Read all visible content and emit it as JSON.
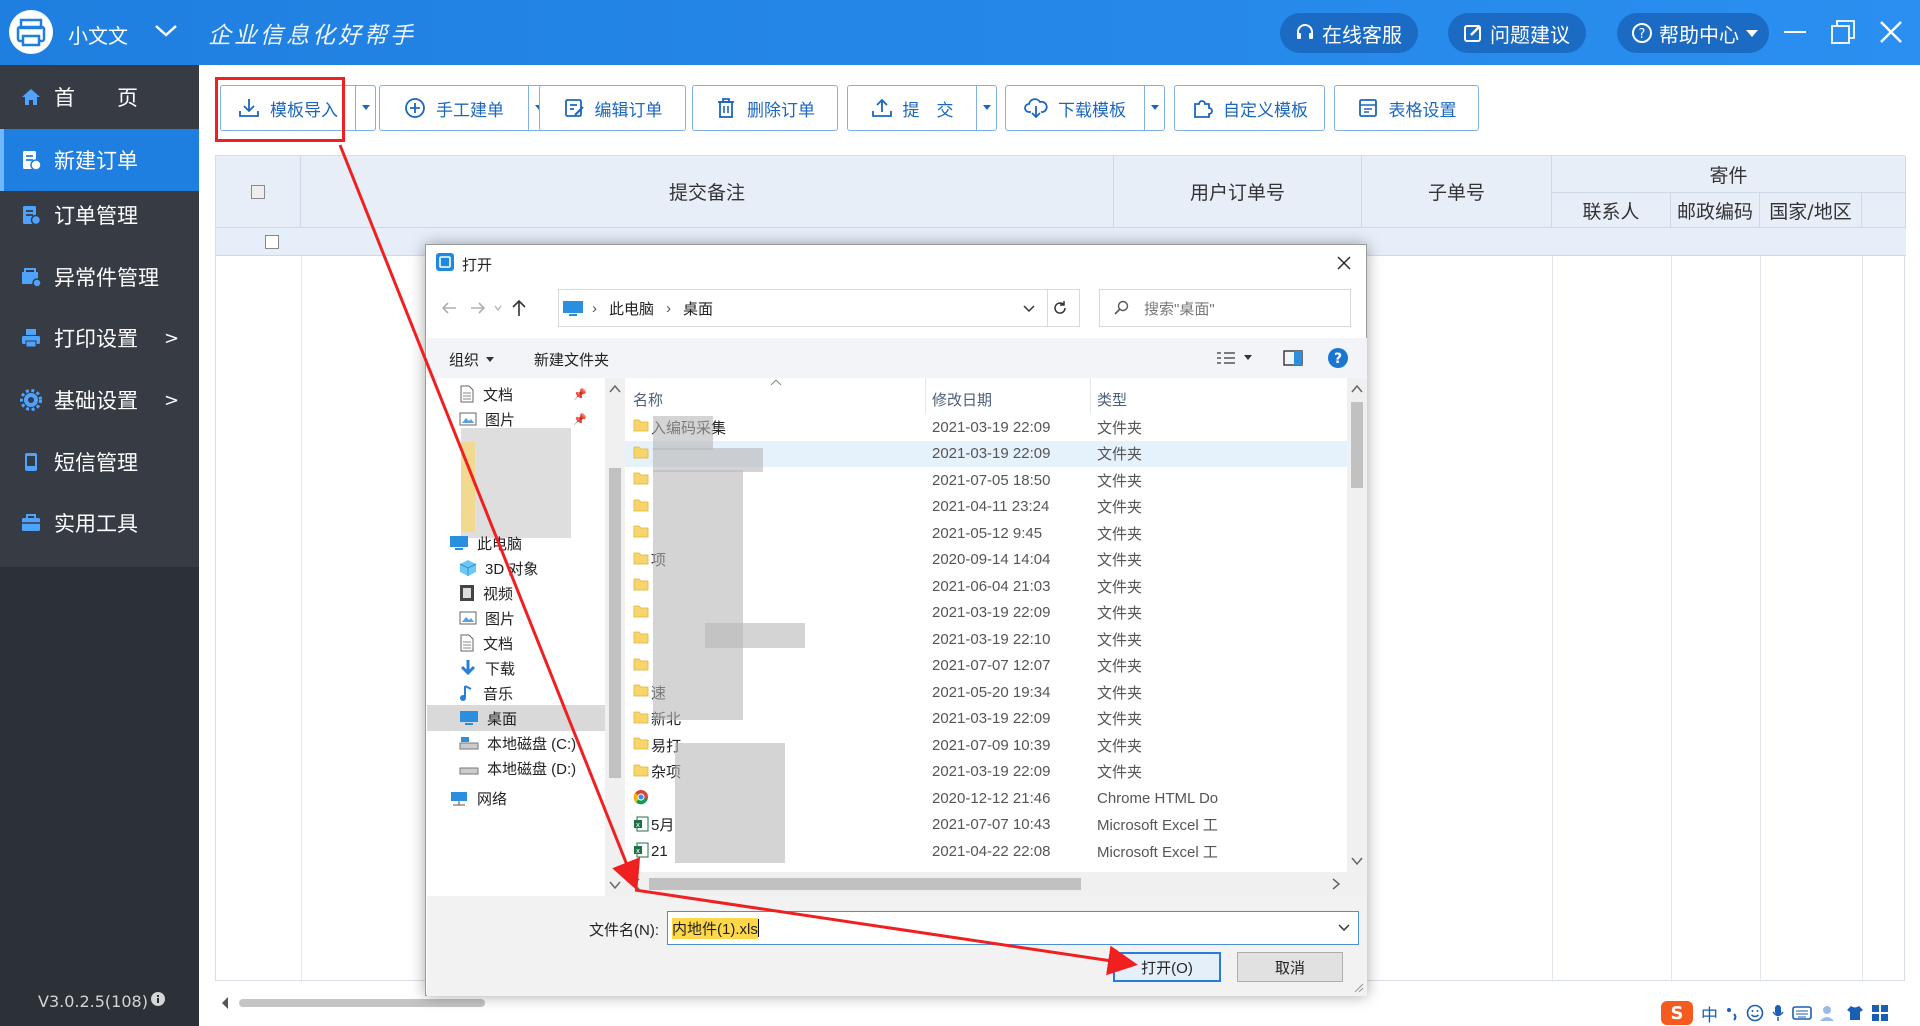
{
  "titlebar": {
    "app_name": "小文文",
    "slogan": "企业信息化好帮手",
    "online_service": "在线客服",
    "feedback": "问题建议",
    "help_center": "帮助中心"
  },
  "sidebar": {
    "items": [
      {
        "label": "首　　页",
        "icon": "home-icon"
      },
      {
        "label": "新建订单",
        "icon": "new-order-icon",
        "active": true
      },
      {
        "label": "订单管理",
        "icon": "order-manage-icon"
      },
      {
        "label": "异常件管理",
        "icon": "exception-icon"
      },
      {
        "label": "打印设置",
        "icon": "printer-icon",
        "arrow": ">"
      },
      {
        "label": "基础设置",
        "icon": "gear-icon",
        "arrow": ">"
      },
      {
        "label": "短信管理",
        "icon": "sms-icon"
      },
      {
        "label": "实用工具",
        "icon": "toolbox-icon"
      }
    ],
    "version": "V3.0.2.5(108)"
  },
  "toolbar": {
    "import_template": "模板导入",
    "manual_order": "手工建单",
    "edit_order": "编辑订单",
    "delete_order": "删除订单",
    "submit": "提　交",
    "download_template": "下载模板",
    "custom_template": "自定义模板",
    "table_settings": "表格设置"
  },
  "table": {
    "headers": {
      "remark": "提交备注",
      "user_order_no": "用户订单号",
      "sub_order_no": "子单号",
      "sender_group": "寄件",
      "contact": "联系人",
      "postcode": "邮政编码",
      "country": "国家/地区"
    }
  },
  "dialog": {
    "title": "打开",
    "breadcrumb": [
      "此电脑",
      "桌面"
    ],
    "search_placeholder": "搜索\"桌面\"",
    "organize": "组织",
    "new_folder": "新建文件夹",
    "nav_items": [
      {
        "label": "文档",
        "icon": "document-icon",
        "pinned": true
      },
      {
        "label": "图片",
        "icon": "picture-icon",
        "pinned": true
      },
      {
        "label": "此电脑",
        "icon": "computer-icon"
      },
      {
        "label": "3D 对象",
        "icon": "3d-object-icon"
      },
      {
        "label": "视频",
        "icon": "video-icon"
      },
      {
        "label": "图片",
        "icon": "picture-icon"
      },
      {
        "label": "文档",
        "icon": "document-icon"
      },
      {
        "label": "下载",
        "icon": "download-icon"
      },
      {
        "label": "音乐",
        "icon": "music-icon"
      },
      {
        "label": "桌面",
        "icon": "desktop-icon",
        "selected": true
      },
      {
        "label": "本地磁盘 (C:)",
        "icon": "drive-icon"
      },
      {
        "label": "本地磁盘 (D:)",
        "icon": "drive-icon"
      },
      {
        "label": "网络",
        "icon": "network-icon"
      }
    ],
    "columns": {
      "name": "名称",
      "date": "修改日期",
      "type": "类型"
    },
    "files": [
      {
        "name": "入编码采集",
        "date": "2021-03-19 22:09",
        "type": "文件夹",
        "icon": "folder"
      },
      {
        "name": "",
        "date": "2021-03-19 22:09",
        "type": "文件夹",
        "icon": "folder"
      },
      {
        "name": "",
        "date": "2021-07-05 18:50",
        "type": "文件夹",
        "icon": "folder"
      },
      {
        "name": "",
        "date": "2021-04-11 23:24",
        "type": "文件夹",
        "icon": "folder"
      },
      {
        "name": "",
        "date": "2021-05-12 9:45",
        "type": "文件夹",
        "icon": "folder"
      },
      {
        "name": "项",
        "date": "2020-09-14 14:04",
        "type": "文件夹",
        "icon": "folder"
      },
      {
        "name": "",
        "date": "2021-06-04 21:03",
        "type": "文件夹",
        "icon": "folder"
      },
      {
        "name": "",
        "date": "2021-03-19 22:09",
        "type": "文件夹",
        "icon": "folder"
      },
      {
        "name": "",
        "date": "2021-03-19 22:10",
        "type": "文件夹",
        "icon": "folder"
      },
      {
        "name": "",
        "date": "2021-07-07 12:07",
        "type": "文件夹",
        "icon": "folder"
      },
      {
        "name": "速",
        "date": "2021-05-20 19:34",
        "type": "文件夹",
        "icon": "folder"
      },
      {
        "name": "新北",
        "date": "2021-03-19 22:09",
        "type": "文件夹",
        "icon": "folder"
      },
      {
        "name": "易打",
        "date": "2021-07-09 10:39",
        "type": "文件夹",
        "icon": "folder"
      },
      {
        "name": "杂项",
        "date": "2021-03-19 22:09",
        "type": "文件夹",
        "icon": "folder"
      },
      {
        "name": "",
        "date": "2020-12-12 21:46",
        "type": "Chrome HTML Do",
        "icon": "chrome"
      },
      {
        "name": "5月",
        "date": "2021-07-07 10:43",
        "type": "Microsoft Excel 工",
        "icon": "excel"
      },
      {
        "name": "21",
        "date": "2021-04-22 22:08",
        "type": "Microsoft Excel 工",
        "icon": "excel"
      }
    ],
    "filename_label": "文件名(N):",
    "filename_value": "内地件(1).xls",
    "open_button": "打开(O)",
    "cancel_button": "取消"
  },
  "tray": {
    "ime": "中"
  },
  "colors": {
    "accent": "#1e7fe0",
    "highlight": "#f02020",
    "sidebar": "#363b44"
  }
}
